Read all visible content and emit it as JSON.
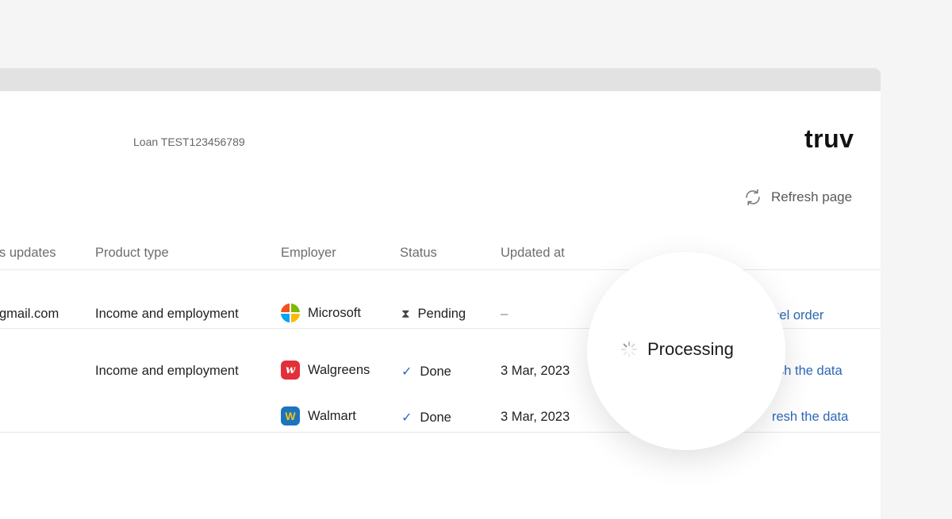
{
  "header": {
    "loan_label": "Loan TEST123456789",
    "logo": "truv",
    "refresh_label": "Refresh page",
    "refresh_icon": "refresh-icon"
  },
  "table": {
    "columns": [
      "s updates",
      "Product type",
      "Employer",
      "Status",
      "Updated at"
    ],
    "rows": [
      {
        "email": "gmail.com",
        "product": "Income and employment",
        "employer": "Microsoft",
        "status": "Pending",
        "status_icon": "hourglass-icon",
        "updated": "–",
        "action": "ncel order"
      },
      {
        "product": "Income and employment",
        "employer": "Walgreens",
        "status": "Done",
        "status_icon": "check-icon",
        "updated": "3 Mar, 2023",
        "action": "sh the data"
      },
      {
        "employer": "Walmart",
        "status": "Done",
        "status_icon": "check-icon",
        "updated": "3 Mar, 2023",
        "action": "resh the data"
      }
    ]
  },
  "overlay": {
    "label": "Processing",
    "icon": "spinner-icon"
  },
  "colors": {
    "link": "#2d68b5",
    "background": "#f5f5f5",
    "titlebar": "#e2e2e2"
  }
}
